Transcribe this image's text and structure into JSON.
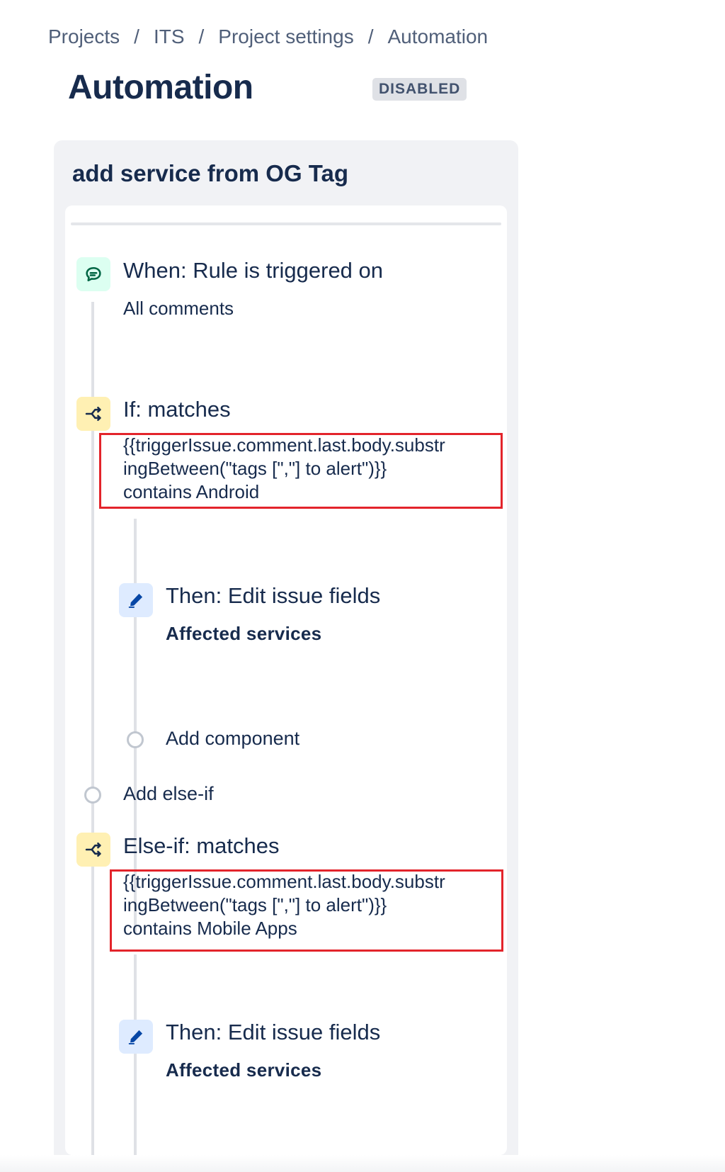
{
  "breadcrumbs": {
    "items": [
      "Projects",
      "ITS",
      "Project settings",
      "Automation"
    ],
    "separator": "/"
  },
  "page": {
    "title": "Automation",
    "status": "DISABLED"
  },
  "rule": {
    "name": "add service from OG Tag",
    "trigger": {
      "icon": "comment-icon",
      "title": "When: Rule is triggered on",
      "detail": "All comments"
    },
    "if_condition": {
      "icon": "branch-icon",
      "title": "If: matches",
      "lines": [
        "{{triggerIssue.comment.last.body.substr",
        "ingBetween(\"tags [\",\"] to alert\")}}",
        "contains Android"
      ],
      "action": {
        "icon": "edit-pencil-icon",
        "title": "Then: Edit issue fields",
        "detail": "Affected services"
      },
      "add_component_label": "Add component"
    },
    "add_else_if_label": "Add else-if",
    "else_if_condition": {
      "icon": "branch-icon",
      "title": "Else-if: matches",
      "lines": [
        "{{triggerIssue.comment.last.body.substr",
        "ingBetween(\"tags [\",\"] to alert\")}}",
        "contains Mobile Apps"
      ],
      "action": {
        "icon": "edit-pencil-icon",
        "title": "Then: Edit issue fields",
        "detail": "Affected services"
      }
    }
  },
  "colors": {
    "highlight": "#e3242b",
    "trigger_icon_bg": "#dcfff1",
    "condition_icon_bg": "#fff0b3",
    "action_icon_bg": "#deebff"
  }
}
